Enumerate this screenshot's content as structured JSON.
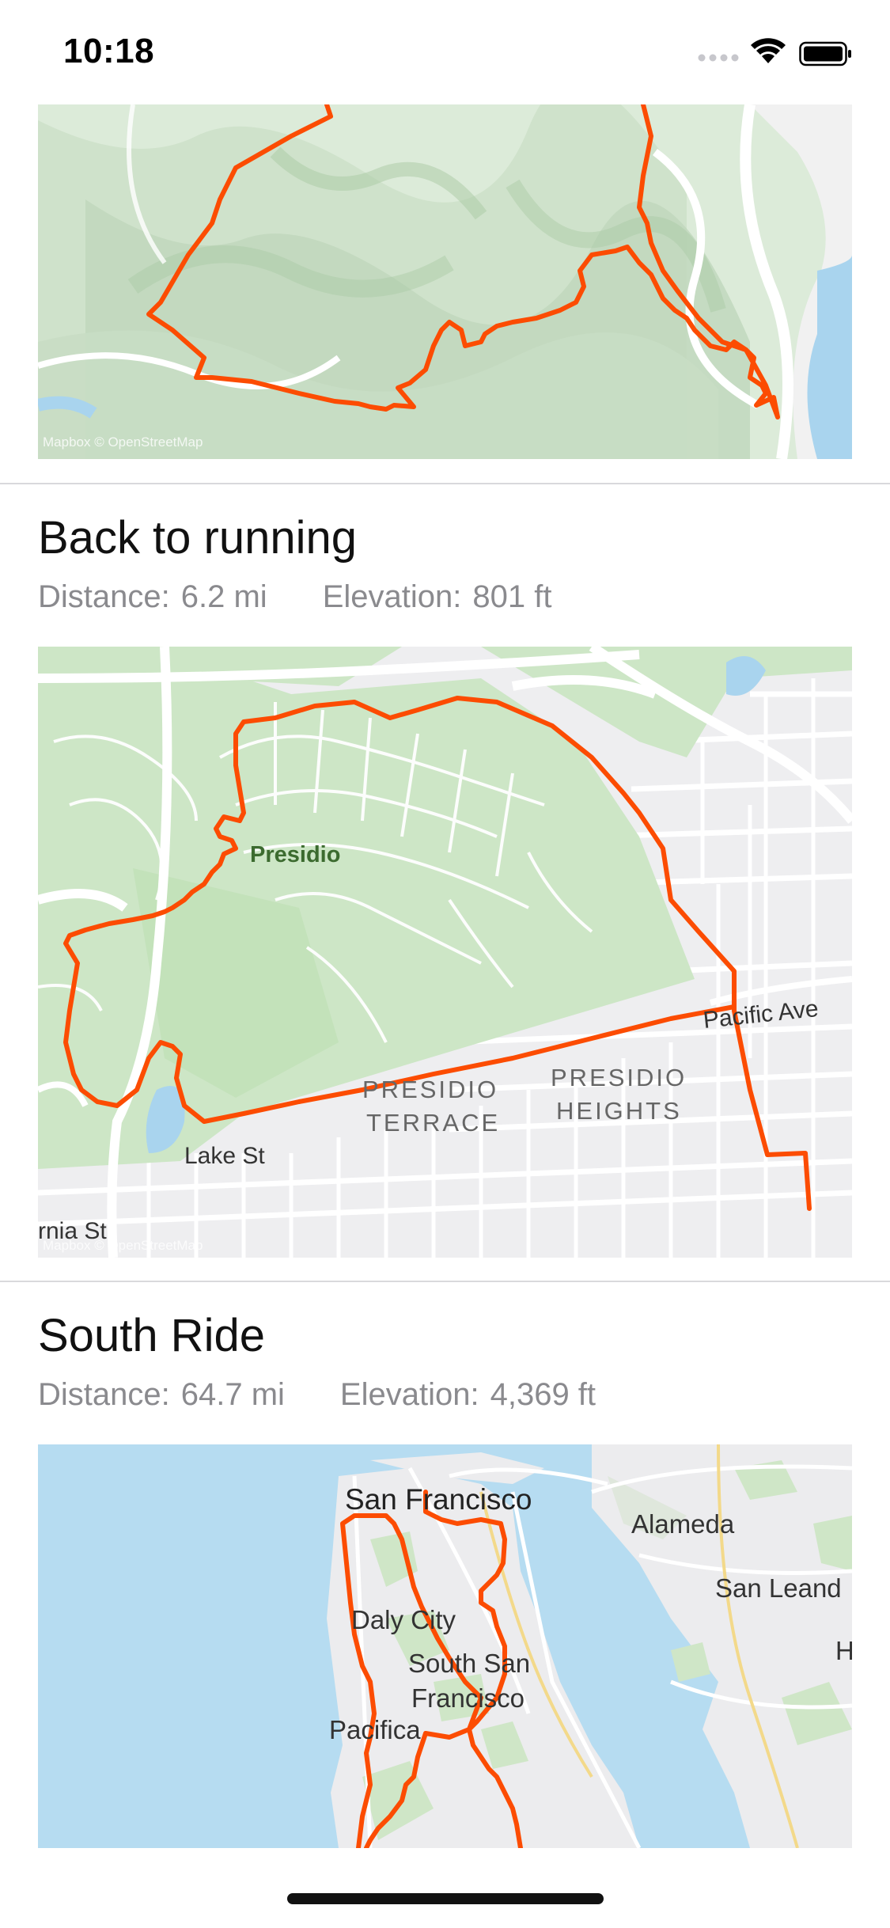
{
  "status_bar": {
    "time": "10:18"
  },
  "attribution": "Mapbox © OpenStreetMap",
  "route_color": "#fc4c02",
  "activities": [
    {
      "title": "",
      "distance_label": "",
      "distance": "",
      "elevation_label": "",
      "elevation": "",
      "map_labels": []
    },
    {
      "title": "Back to running",
      "distance_label": "Distance:",
      "distance": "6.2 mi",
      "elevation_label": "Elevation:",
      "elevation": "801 ft",
      "map_labels": {
        "presidio": "Presidio",
        "pacific_ave": "Pacific Ave",
        "presidio_terrace_1": "PRESIDIO",
        "presidio_terrace_2": "TERRACE",
        "presidio_heights_1": "PRESIDIO",
        "presidio_heights_2": "HEIGHTS",
        "lake_st": "Lake St",
        "california_st": "rnia St"
      }
    },
    {
      "title": "South Ride",
      "distance_label": "Distance:",
      "distance": "64.7 mi",
      "elevation_label": "Elevation:",
      "elevation": "4,369 ft",
      "map_labels": {
        "san_francisco": "San Francisco",
        "alameda": "Alameda",
        "san_leandro": "San Leand",
        "daly_city": "Daly City",
        "south_sf_1": "South San",
        "south_sf_2": "Francisco",
        "pacifica": "Pacifica",
        "h": "H"
      }
    }
  ]
}
